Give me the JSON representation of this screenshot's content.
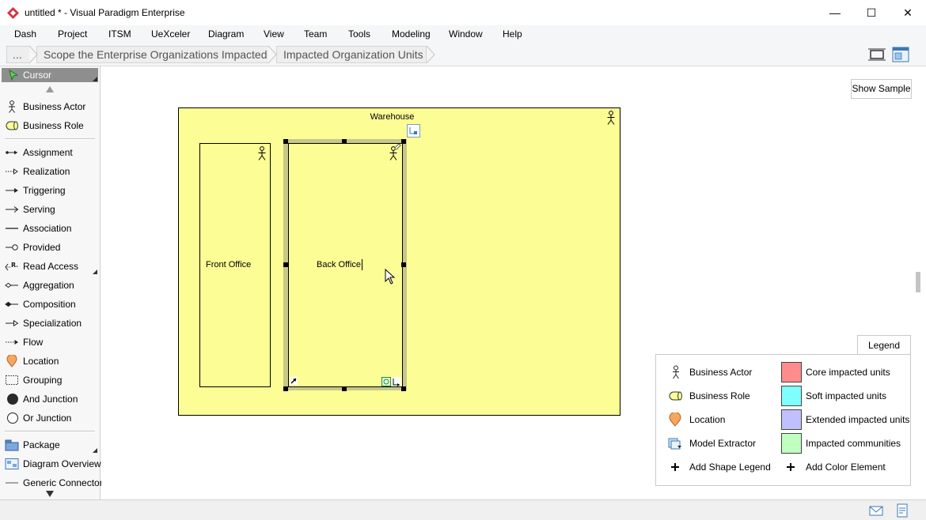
{
  "window": {
    "title": "untitled * - Visual Paradigm Enterprise",
    "minimize": "—",
    "maximize": "☐",
    "close": "✕"
  },
  "menu": [
    "Dash",
    "Project",
    "ITSM",
    "UeXceler",
    "Diagram",
    "View",
    "Team",
    "Tools",
    "Modeling",
    "Window",
    "Help"
  ],
  "breadcrumb": {
    "more": "...",
    "items": [
      "Scope the Enterprise Organizations Impacted",
      "Impacted Organization Units"
    ]
  },
  "palette": {
    "cursor": "Cursor",
    "items": [
      {
        "label": "Business Actor",
        "icon": "business-actor-icon"
      },
      {
        "label": "Business Role",
        "icon": "business-role-icon"
      },
      {
        "label": "Assignment",
        "icon": "assignment-icon"
      },
      {
        "label": "Realization",
        "icon": "realization-icon"
      },
      {
        "label": "Triggering",
        "icon": "triggering-icon"
      },
      {
        "label": "Serving",
        "icon": "serving-icon"
      },
      {
        "label": "Association",
        "icon": "association-icon"
      },
      {
        "label": "Provided",
        "icon": "provided-icon"
      },
      {
        "label": "Read Access",
        "icon": "read-access-icon"
      },
      {
        "label": "Aggregation",
        "icon": "aggregation-icon"
      },
      {
        "label": "Composition",
        "icon": "composition-icon"
      },
      {
        "label": "Specialization",
        "icon": "specialization-icon"
      },
      {
        "label": "Flow",
        "icon": "flow-icon"
      },
      {
        "label": "Location",
        "icon": "location-icon"
      },
      {
        "label": "Grouping",
        "icon": "grouping-icon"
      },
      {
        "label": "And Junction",
        "icon": "and-junction-icon"
      },
      {
        "label": "Or Junction",
        "icon": "or-junction-icon"
      },
      {
        "label": "Package",
        "icon": "package-icon"
      },
      {
        "label": "Diagram Overview",
        "icon": "diagram-overview-icon"
      },
      {
        "label": "Generic Connector",
        "icon": "generic-connector-icon"
      }
    ]
  },
  "canvas": {
    "show_sample": "Show Sample",
    "shapes": {
      "warehouse": "Warehouse",
      "front_office": "Front Office",
      "back_office": "Back Office"
    }
  },
  "legend": {
    "tab": "Legend",
    "shapes": [
      {
        "label": "Business Actor",
        "icon": "business-actor-icon"
      },
      {
        "label": "Business Role",
        "icon": "business-role-icon"
      },
      {
        "label": "Location",
        "icon": "location-icon"
      },
      {
        "label": "Model Extractor",
        "icon": "model-extractor-icon"
      }
    ],
    "colors": [
      {
        "label": "Core impacted units",
        "color": "#ff8c8c"
      },
      {
        "label": "Soft impacted units",
        "color": "#80ffff"
      },
      {
        "label": "Extended impacted units",
        "color": "#c0c0ff"
      },
      {
        "label": "Impacted communities",
        "color": "#c0ffc0"
      }
    ],
    "add_shape": "Add Shape Legend",
    "add_color": "Add Color Element"
  },
  "colors": {
    "element_fill": "#fdfd96",
    "selection_frame": "#c8c88a"
  }
}
